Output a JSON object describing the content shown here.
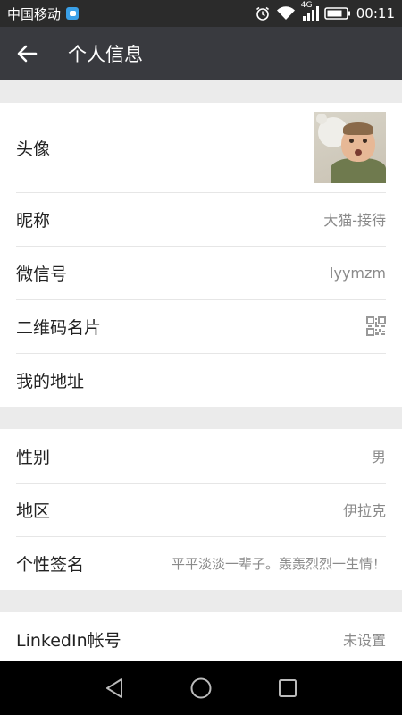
{
  "status_bar": {
    "carrier": "中国移动",
    "network": "4G",
    "time": "00:11"
  },
  "header": {
    "title": "个人信息",
    "back_icon": "arrow-left-icon"
  },
  "groups": [
    {
      "rows": [
        {
          "label": "头像",
          "type": "avatar"
        },
        {
          "label": "昵称",
          "value": "大猫-接待"
        },
        {
          "label": "微信号",
          "value": "lyymzm"
        },
        {
          "label": "二维码名片",
          "type": "qr"
        },
        {
          "label": "我的地址",
          "value": ""
        }
      ]
    },
    {
      "rows": [
        {
          "label": "性别",
          "value": "男"
        },
        {
          "label": "地区",
          "value": "伊拉克"
        },
        {
          "label": "个性签名",
          "value": "平平淡淡一辈子。轰轰烈烈一生情！"
        }
      ]
    },
    {
      "rows": [
        {
          "label": "LinkedIn帐号",
          "value": "未设置"
        }
      ]
    }
  ],
  "colors": {
    "titlebar": "#393a3f",
    "statusbar": "#2b2b2b",
    "background": "#ebebeb",
    "label": "#222222",
    "value": "#8a8a8a"
  }
}
